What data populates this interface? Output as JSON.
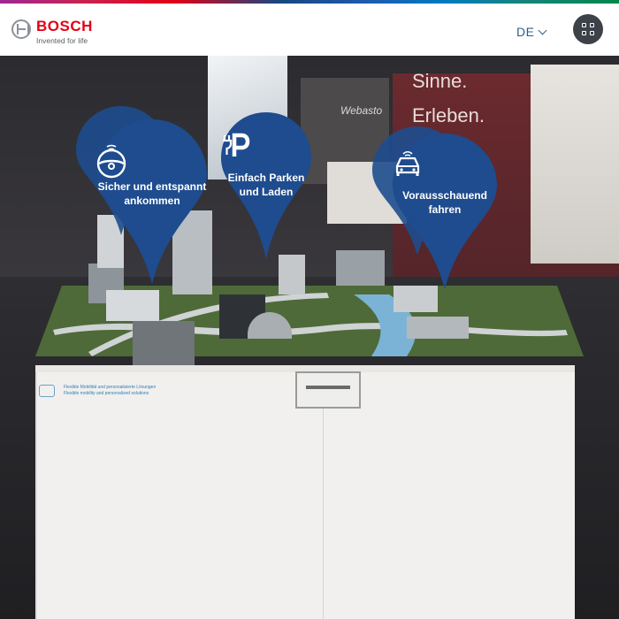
{
  "header": {
    "brand": "BOSCH",
    "tagline": "Invented for life",
    "language": "DE"
  },
  "scene": {
    "wall_text_1": "Sinne.",
    "wall_text_2": "Erleben.",
    "wall_brand": "Webasto",
    "table_info_de": "Flexible Mobilität und personalisierte Lösungen",
    "table_info_en": "Flexible mobility and personalized solutions"
  },
  "pins": [
    {
      "label": "Sicher und entspannt ankommen",
      "icon": "steering-wheel-icon"
    },
    {
      "label": "Einfach Parken und Laden",
      "icon": "parking-charging-icon"
    },
    {
      "label": "Vorausschauend fahren",
      "icon": "connected-car-icon"
    }
  ],
  "colors": {
    "pin": "#1e4c8e",
    "bosch_red": "#e20015",
    "menu_button": "#3d4148"
  }
}
